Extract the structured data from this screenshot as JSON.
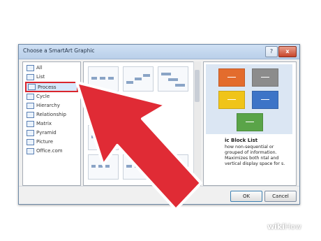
{
  "dialog": {
    "title": "Choose a SmartArt Graphic",
    "help_label": "?",
    "close_label": "x"
  },
  "categories": [
    {
      "label": "All",
      "icon": "all-icon"
    },
    {
      "label": "List",
      "icon": "list-icon"
    },
    {
      "label": "Process",
      "icon": "process-icon",
      "selected": true
    },
    {
      "label": "Cycle",
      "icon": "cycle-icon"
    },
    {
      "label": "Hierarchy",
      "icon": "hierarchy-icon"
    },
    {
      "label": "Relationship",
      "icon": "relationship-icon"
    },
    {
      "label": "Matrix",
      "icon": "matrix-icon"
    },
    {
      "label": "Pyramid",
      "icon": "pyramid-icon"
    },
    {
      "label": "Picture",
      "icon": "picture-icon"
    },
    {
      "label": "Office.com",
      "icon": "office-com-icon"
    }
  ],
  "preview": {
    "title": "ic Block List",
    "description": "how non-sequential or grouped of information. Maximizes both ntal and vertical display space for s.",
    "block_colors": [
      "#e36c2d",
      "#8c8c8c",
      "#f0c419",
      "#3d74c7",
      "#5aa448"
    ]
  },
  "buttons": {
    "ok": "OK",
    "cancel": "Cancel"
  },
  "watermark": {
    "wiki": "wiki",
    "how": "How"
  },
  "accent_color": "#e02b35"
}
